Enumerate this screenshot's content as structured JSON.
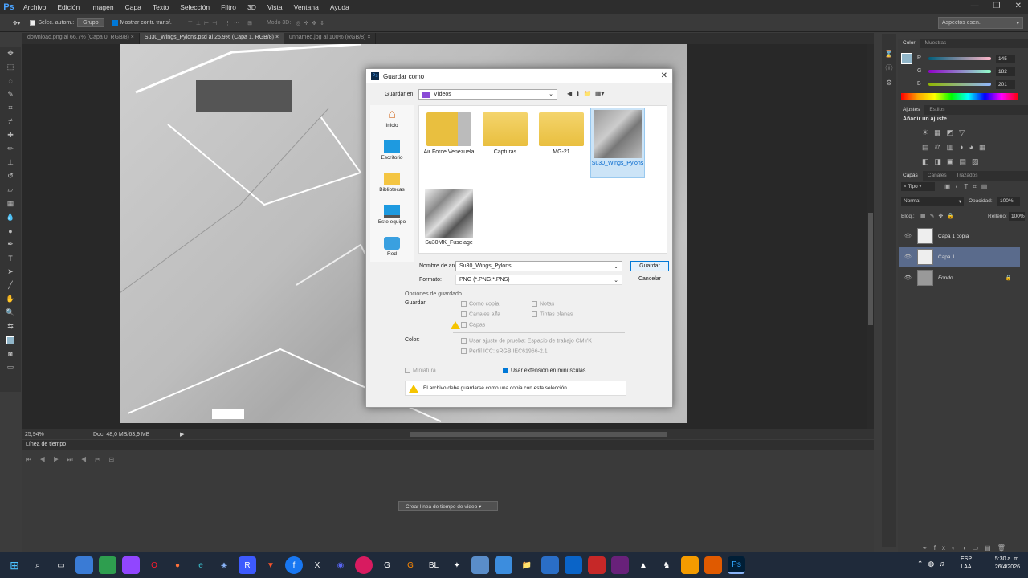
{
  "app": {
    "logo": "Ps"
  },
  "menu": [
    "Archivo",
    "Edición",
    "Imagen",
    "Capa",
    "Texto",
    "Selección",
    "Filtro",
    "3D",
    "Vista",
    "Ventana",
    "Ayuda"
  ],
  "options": {
    "auto_select": "Selec. autom.:",
    "group": "Grupo",
    "show_transform": "Mostrar contr. transf.",
    "mode3d": "Modo 3D:",
    "workspace": "Aspectos esen."
  },
  "tabs": [
    "download.png al 66,7% (Capa 0, RGB/8)",
    "Su30_Wings_Pylons.psd al 25,9% (Capa 1, RGB/8)",
    "unnamed.jpg al 100% (RGB/8)"
  ],
  "status": {
    "zoom": "25,94%",
    "doc": "Doc: 48,0 MB/63,9 MB"
  },
  "timeline": {
    "title": "Línea de tiempo",
    "create_button": "Crear línea de tiempo de vídeo"
  },
  "panels": {
    "color_tabs": [
      "Color",
      "Muestras"
    ],
    "color": {
      "r_label": "R",
      "g_label": "G",
      "b_label": "B",
      "r": "145",
      "g": "182",
      "b": "201"
    },
    "adjust_tabs": [
      "Ajustes",
      "Estilos"
    ],
    "adjust_title": "Añadir un ajuste",
    "layer_tabs": [
      "Capas",
      "Canales",
      "Trazados"
    ],
    "filter_kind": "Tipo",
    "blend_mode": "Normal",
    "opacity_label": "Opacidad:",
    "opacity": "100%",
    "lock_label": "Bloq.:",
    "fill_label": "Relleno:",
    "fill": "100%",
    "layers": [
      "Capa 1 copia",
      "Capa 1",
      "Fondo"
    ]
  },
  "dialog": {
    "title": "Guardar como",
    "save_in_label": "Guardar en:",
    "save_in_value": "Vídeos",
    "places": [
      "Inicio",
      "Escritorio",
      "Bibliotecas",
      "Este equipo",
      "Red"
    ],
    "files": [
      "Air Force Venezuela",
      "Capturas",
      "MG-21",
      "Su30_Wings_Pylons",
      "Su30MK_Fuselage"
    ],
    "filename_label": "Nombre de arc",
    "filename_value": "Su30_Wings_Pylons",
    "format_label": "Formato:",
    "format_value": "PNG (*.PNG;*.PNS)",
    "save_button": "Guardar",
    "cancel_button": "Cancelar",
    "options_title": "Opciones de guardado",
    "save_label": "Guardar:",
    "as_copy": "Como copia",
    "alpha": "Canales alfa",
    "layers_opt": "Capas",
    "notes": "Notas",
    "spot": "Tintas planas",
    "color_label": "Color:",
    "proof": "Usar ajuste de prueba: Espacio de trabajo CMYK",
    "icc": "Perfil ICC: sRGB IEC61966-2.1",
    "thumbnail": "Miniatura",
    "lowercase": "Usar extensión en minúsculas",
    "warning": "El archivo debe guardarse como una copia con esta selección."
  },
  "system": {
    "lang1": "ESP",
    "lang2": "LAA",
    "time": "5:30 a. m.",
    "date": "26/4/2026"
  }
}
